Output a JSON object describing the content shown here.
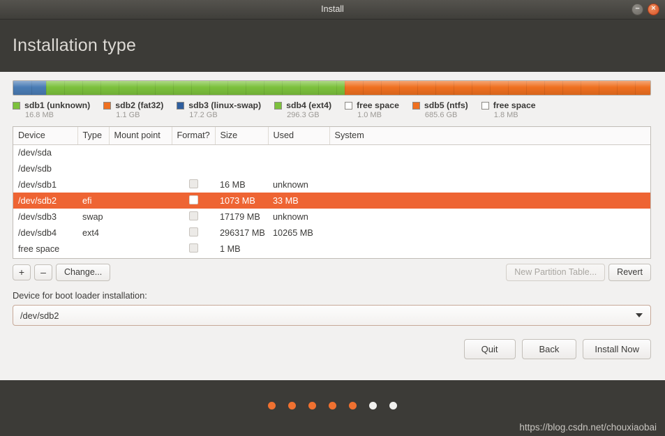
{
  "window": {
    "title": "Install",
    "minimize_icon": "minimize-icon",
    "minimize_glyph": "–",
    "close_icon": "close-icon",
    "close_glyph": "×"
  },
  "header": {
    "page_title": "Installation type"
  },
  "partition_bar": {
    "segments": [
      {
        "name": "sdb1 (unknown)",
        "color": "#4a7cb5",
        "width_pct": 5.2
      },
      {
        "name": "sdb4 (ext4)",
        "color": "#7cc13c",
        "width_pct": 46.8
      },
      {
        "name": "sdb5 (ntfs)",
        "color": "#ef7020",
        "width_pct": 48.0
      }
    ]
  },
  "legend": [
    {
      "label": "sdb1 (unknown)",
      "size": "16.8 MB",
      "color": "#7cc13c"
    },
    {
      "label": "sdb2 (fat32)",
      "size": "1.1 GB",
      "color": "#ef7020"
    },
    {
      "label": "sdb3 (linux-swap)",
      "size": "17.2 GB",
      "color": "#2e5e9e"
    },
    {
      "label": "sdb4 (ext4)",
      "size": "296.3 GB",
      "color": "#7cc13c"
    },
    {
      "label": "free space",
      "size": "1.0 MB",
      "color": "#ffffff"
    },
    {
      "label": "sdb5 (ntfs)",
      "size": "685.6 GB",
      "color": "#ef7020"
    },
    {
      "label": "free space",
      "size": "1.8 MB",
      "color": "#ffffff"
    }
  ],
  "table": {
    "columns": [
      "Device",
      "Type",
      "Mount point",
      "Format?",
      "Size",
      "Used",
      "System"
    ],
    "rows": [
      {
        "device": "/dev/sda",
        "type": "",
        "mount": "",
        "format": false,
        "size": "",
        "used": "",
        "system": "",
        "selected": false,
        "has_checkbox": false
      },
      {
        "device": "/dev/sdb",
        "type": "",
        "mount": "",
        "format": false,
        "size": "",
        "used": "",
        "system": "",
        "selected": false,
        "has_checkbox": false
      },
      {
        "device": "/dev/sdb1",
        "type": "",
        "mount": "",
        "format": false,
        "size": "16 MB",
        "used": "unknown",
        "system": "",
        "selected": false,
        "has_checkbox": true
      },
      {
        "device": "/dev/sdb2",
        "type": "efi",
        "mount": "",
        "format": false,
        "size": "1073 MB",
        "used": "33 MB",
        "system": "",
        "selected": true,
        "has_checkbox": true
      },
      {
        "device": "/dev/sdb3",
        "type": "swap",
        "mount": "",
        "format": false,
        "size": "17179 MB",
        "used": "unknown",
        "system": "",
        "selected": false,
        "has_checkbox": true
      },
      {
        "device": "/dev/sdb4",
        "type": "ext4",
        "mount": "",
        "format": false,
        "size": "296317 MB",
        "used": "10265 MB",
        "system": "",
        "selected": false,
        "has_checkbox": true
      },
      {
        "device": "free space",
        "type": "",
        "mount": "",
        "format": false,
        "size": "1 MB",
        "used": "",
        "system": "",
        "selected": false,
        "has_checkbox": true
      }
    ]
  },
  "toolbar": {
    "add_label": "+",
    "remove_label": "–",
    "change_label": "Change...",
    "new_partition_table_label": "New Partition Table...",
    "new_partition_table_disabled": true,
    "revert_label": "Revert"
  },
  "bootloader": {
    "label": "Device for boot loader installation:",
    "selected_value": "/dev/sdb2",
    "dropdown_icon": "chevron-down-icon"
  },
  "actions": {
    "quit_label": "Quit",
    "back_label": "Back",
    "install_label": "Install Now"
  },
  "footer": {
    "dots_total": 7,
    "dots_active": 5,
    "watermark": "https://blog.csdn.net/chouxiaobai"
  }
}
